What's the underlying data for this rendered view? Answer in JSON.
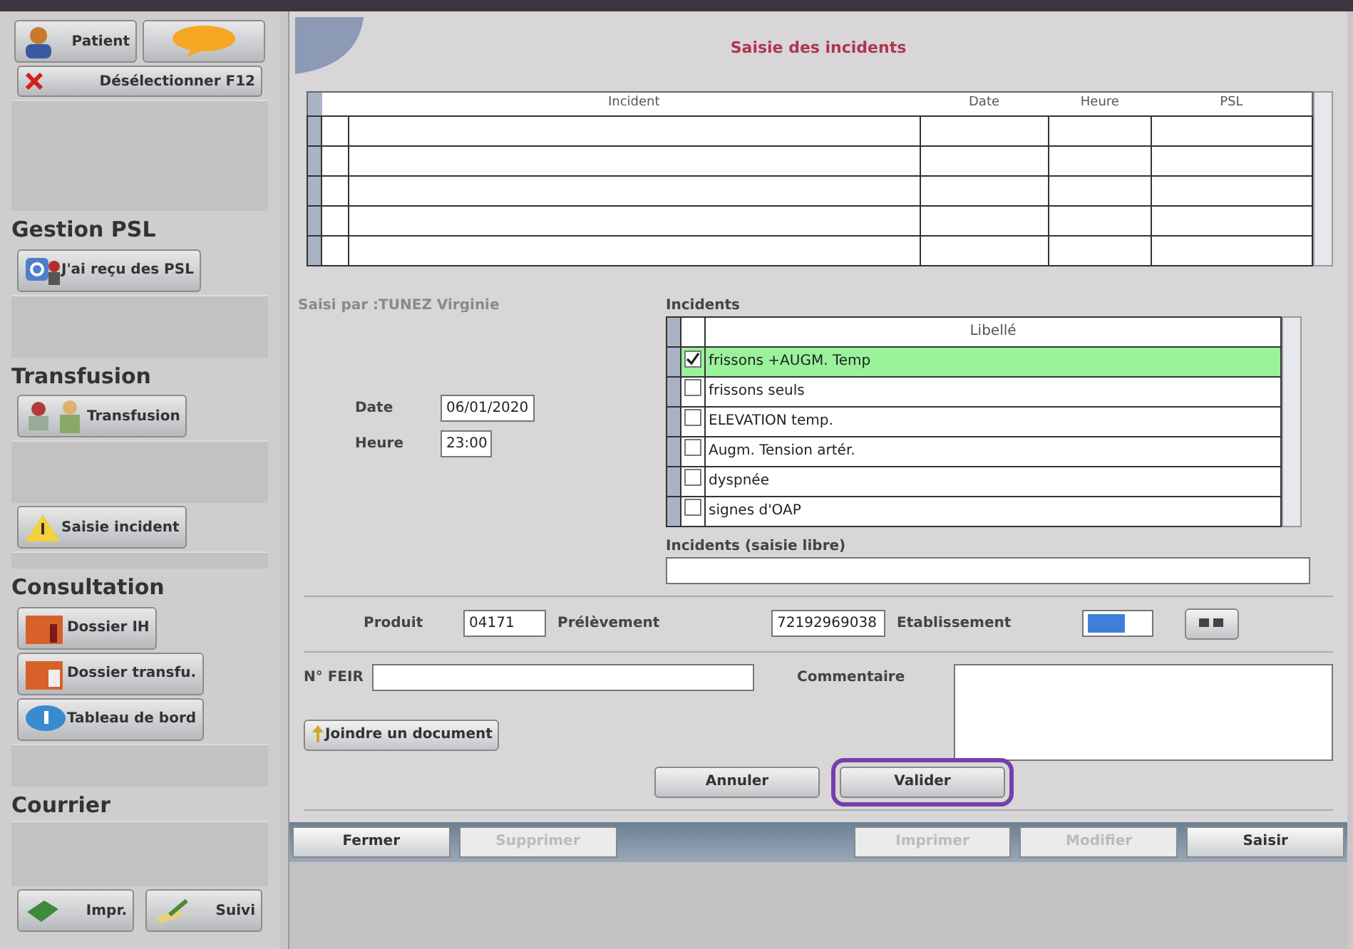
{
  "sidebar": {
    "top_buttons": [
      {
        "kind": "text",
        "label": "Patient"
      },
      {
        "kind": "icon"
      }
    ],
    "deselect_button": {
      "label": "Désélectionner F12"
    },
    "sections": [
      {
        "title": "Gestion PSL",
        "buttons": [
          {
            "label": "J'ai reçu des PSL"
          }
        ]
      },
      {
        "title": "Transfusion",
        "buttons": [
          {
            "label": "Transfusion"
          },
          {
            "label": "Saisie incident"
          }
        ]
      },
      {
        "title": "Consultation",
        "buttons": [
          {
            "label": "Dossier IH"
          },
          {
            "label": "Dossier transfu."
          },
          {
            "label": "Tableau de bord"
          }
        ]
      },
      {
        "title": "Courrier",
        "buttons": [
          {
            "label": "Impr."
          },
          {
            "label": "Suivi"
          }
        ]
      }
    ]
  },
  "window": {
    "title": "Saisie des incidents"
  },
  "table": {
    "columns": [
      "Incident",
      "Date",
      "Heure",
      "PSL"
    ]
  },
  "form": {
    "entered_by": "Saisi par :TUNEZ  Virginie",
    "date": {
      "label": "Date",
      "value": "06/01/2020"
    },
    "time": {
      "label": "Heure",
      "value": "23:00"
    },
    "incidents": {
      "label": "Incidents",
      "column": "Libellé",
      "rows": [
        {
          "label": "frissons +AUGM. Temp",
          "checked": true,
          "selected": true
        },
        {
          "label": "frissons seuls",
          "checked": false,
          "selected": false
        },
        {
          "label": "ELEVATION temp.",
          "checked": false,
          "selected": false
        },
        {
          "label": "Augm. Tension artér.",
          "checked": false,
          "selected": false
        },
        {
          "label": "dyspnée",
          "checked": false,
          "selected": false
        },
        {
          "label": "signes d'OAP",
          "checked": false,
          "selected": false
        }
      ]
    },
    "free_text": {
      "label": "Incidents (saisie libre)"
    },
    "product": {
      "label": "Produit",
      "value": "04171"
    },
    "sample": {
      "label": "Prélèvement",
      "value": "72192969038"
    },
    "establishment": {
      "label": "Etablissement",
      "value_selected": true
    },
    "feir": {
      "label": "N° FEIR"
    },
    "comment": {
      "label": "Commentaire"
    },
    "attach_button": "Joindre un document",
    "actions": [
      {
        "label": "Annuler",
        "highlighted": false
      },
      {
        "label": "Valider",
        "highlighted": true
      }
    ]
  },
  "toolbar": [
    {
      "label": "Fermer",
      "disabled": false
    },
    {
      "label": "Supprimer",
      "disabled": true
    },
    {
      "label": "Imprimer",
      "disabled": true
    },
    {
      "label": "Modifier",
      "disabled": true
    },
    {
      "label": "Saisir",
      "disabled": false
    }
  ]
}
